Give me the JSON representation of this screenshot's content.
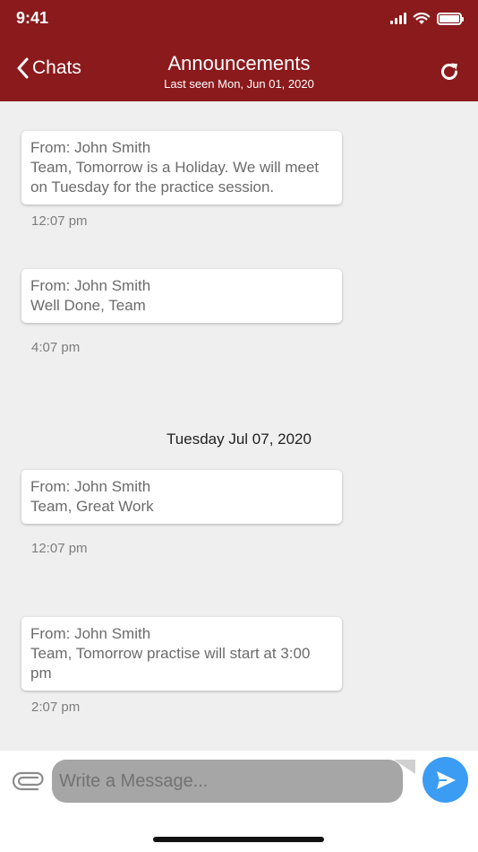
{
  "status_bar": {
    "time": "9:41"
  },
  "header": {
    "back_label": "Chats",
    "title": "Announcements",
    "subtitle": "Last seen Mon, Jun 01, 2020"
  },
  "messages": [
    {
      "from": "From: John Smith",
      "text": "Team, Tomorrow is a Holiday. We will meet on Tuesday for the practice session.",
      "time": "12:07 pm"
    },
    {
      "from": "From: John Smith",
      "text": "Well Done, Team",
      "time": "4:07 pm"
    },
    {
      "from": "From: John Smith",
      "text": "Team, Great Work",
      "time": "12:07 pm"
    },
    {
      "from": "From: John Smith",
      "text": "Team, Tomorrow practise will start at 3:00 pm",
      "time": "2:07 pm"
    }
  ],
  "date_separator": "Tuesday Jul 07, 2020",
  "composer": {
    "placeholder": "Write a Message..."
  },
  "colors": {
    "header": "#8b1a1c",
    "send": "#3b9cf3"
  }
}
